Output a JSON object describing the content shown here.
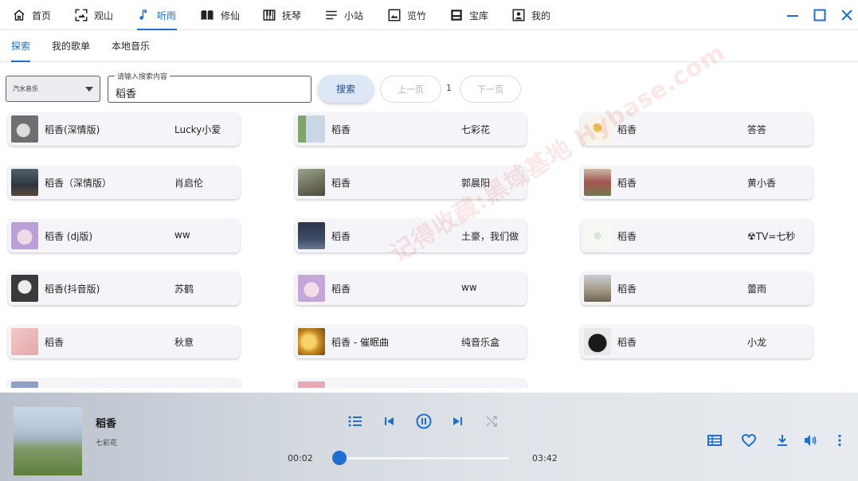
{
  "nav": {
    "items": [
      {
        "label": "首页",
        "icon": "home-icon"
      },
      {
        "label": "观山",
        "icon": "scan-icon"
      },
      {
        "label": "听雨",
        "icon": "music-note-icon"
      },
      {
        "label": "修仙",
        "icon": "book-icon"
      },
      {
        "label": "抚琴",
        "icon": "piano-icon"
      },
      {
        "label": "小站",
        "icon": "menu-lines-icon"
      },
      {
        "label": "览竹",
        "icon": "image-icon"
      },
      {
        "label": "宝库",
        "icon": "inbox-icon"
      },
      {
        "label": "我的",
        "icon": "account-box-icon"
      }
    ],
    "active": "听雨"
  },
  "tabs": {
    "items": [
      "探索",
      "我的歌单",
      "本地音乐"
    ],
    "active": "探索"
  },
  "search": {
    "source": "汽水音乐",
    "label": "请输入搜索内容",
    "value": "稻香",
    "button": "搜索",
    "prev": "上一页",
    "page": "1",
    "next": "下一页"
  },
  "songs": [
    {
      "title": "稻香(深情版)",
      "artist": "Lucky小爱"
    },
    {
      "title": "稻香",
      "artist": "七彩花"
    },
    {
      "title": "稻香",
      "artist": "答答"
    },
    {
      "title": "稻香（深情版）",
      "artist": "肖启伦"
    },
    {
      "title": "稻香",
      "artist": "郭晨阳"
    },
    {
      "title": "稻香",
      "artist": "黄小香"
    },
    {
      "title": "稻香 (dj版)",
      "artist": "ww"
    },
    {
      "title": "稻香",
      "artist": "土豪，我们做"
    },
    {
      "title": "稻香",
      "artist": "☢TV=七秒"
    },
    {
      "title": "稻香(抖音版)",
      "artist": "苏鹤"
    },
    {
      "title": "稻香",
      "artist": "ww"
    },
    {
      "title": "稻香",
      "artist": "蕾雨"
    },
    {
      "title": "稻香",
      "artist": "秋意"
    },
    {
      "title": "稻香 - 催眠曲",
      "artist": "纯音乐盒"
    },
    {
      "title": "稻香",
      "artist": "小龙"
    },
    {
      "title": "",
      "artist": ""
    },
    {
      "title": "",
      "artist": ""
    }
  ],
  "watermark": "记得收藏:黑域基地 Hybase.com",
  "player": {
    "title": "稻香",
    "artist": "七彩花",
    "current_time": "00:02",
    "total_time": "03:42",
    "progress": 0.01
  },
  "colors": {
    "accent": "#1e6fd0"
  }
}
